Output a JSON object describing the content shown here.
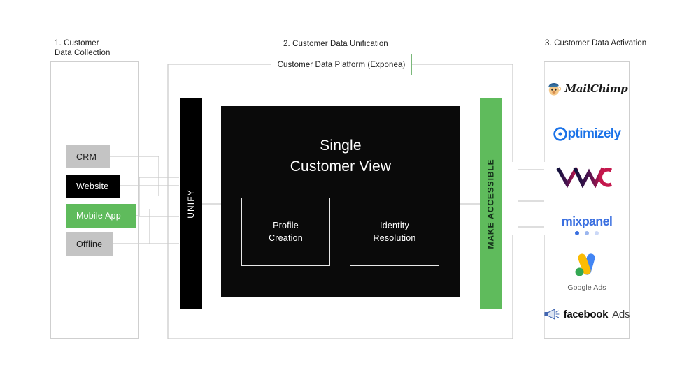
{
  "columns": {
    "left": {
      "caption": "1. Customer\nData Collection"
    },
    "middle": {
      "caption": "2. Customer Data Unification",
      "platform_label": "Customer Data Platform (Exponea)"
    },
    "right": {
      "caption": "3. Customer Data Activation"
    }
  },
  "sources": [
    {
      "label": "CRM",
      "style": "gray"
    },
    {
      "label": "Website",
      "style": "black"
    },
    {
      "label": "Mobile App",
      "style": "green"
    },
    {
      "label": "Offline",
      "style": "gray"
    }
  ],
  "pipeline": {
    "unify_label": "UNIFY",
    "make_accessible_label": "MAKE ACCESSIBLE",
    "scv_title_line1": "Single",
    "scv_title_line2": "Customer View",
    "inner": [
      {
        "line1": "Profile",
        "line2": "Creation"
      },
      {
        "line1": "Identity",
        "line2": "Resolution"
      }
    ]
  },
  "destinations": [
    {
      "name": "MailChimp",
      "text": "MailChimp"
    },
    {
      "name": "Optimizely",
      "text": "ptimizely"
    },
    {
      "name": "VWO",
      "text": "VWO"
    },
    {
      "name": "Mixpanel",
      "text": "mixpanel"
    },
    {
      "name": "Google Ads",
      "text": "Google Ads"
    },
    {
      "name": "Facebook Ads",
      "text_bold": "facebook",
      "text_light": "Ads"
    }
  ],
  "colors": {
    "green": "#5fbb5c",
    "green_border": "#7ab87a",
    "gray_chip": "#c4c4c4",
    "black": "#000000",
    "line": "#c9c9c9",
    "container_border": "#cfcfcf",
    "optimizely_blue": "#1a72e8",
    "mixpanel_blue": "#3a6fe0",
    "vwo_navy": "#1c1548",
    "vwo_crimson": "#c4174c"
  }
}
